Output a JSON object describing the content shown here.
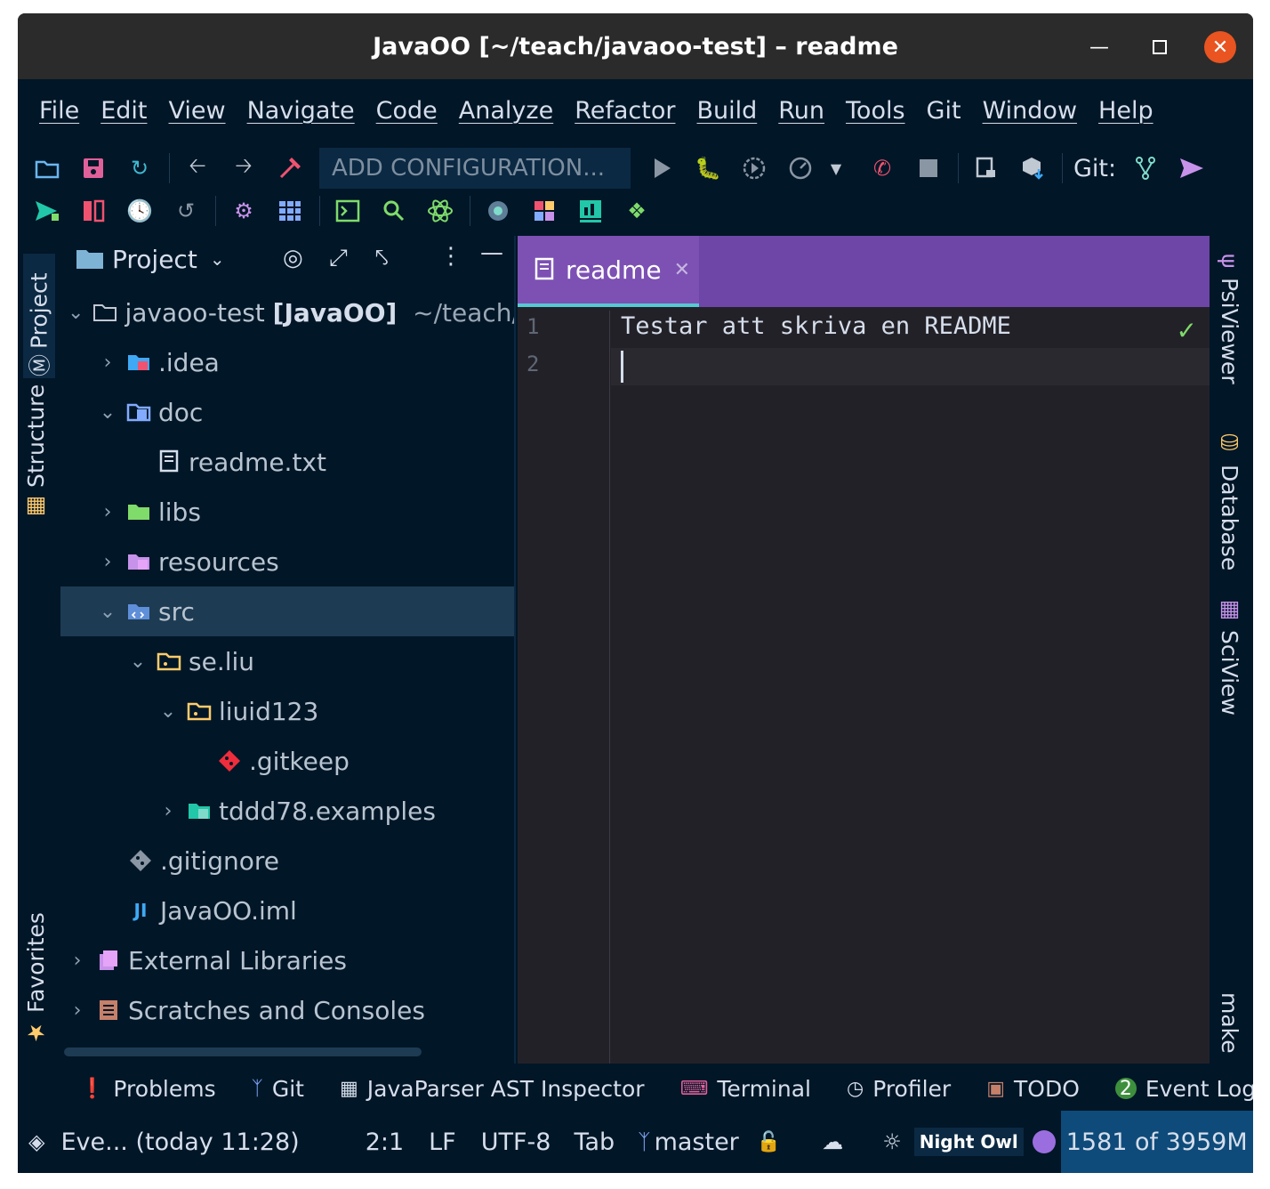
{
  "window": {
    "title": "JavaOO [~/teach/javaoo-test] – readme"
  },
  "menu": [
    "File",
    "Edit",
    "View",
    "Navigate",
    "Code",
    "Analyze",
    "Refactor",
    "Build",
    "Run",
    "Tools",
    "Git",
    "Window",
    "Help"
  ],
  "toolbar": {
    "add_config": "ADD CONFIGURATION...",
    "git_label": "Git:"
  },
  "left_tabs": {
    "project": "Project",
    "structure": "Structure",
    "favorites": "Favorites"
  },
  "project_panel": {
    "title": "Project",
    "tree": [
      {
        "name": "javaoo-test",
        "module": "[JavaOO]",
        "path": "~/teach/ja"
      },
      {
        "name": ".idea"
      },
      {
        "name": "doc"
      },
      {
        "name": "readme.txt"
      },
      {
        "name": "libs"
      },
      {
        "name": "resources"
      },
      {
        "name": "src"
      },
      {
        "name": "se.liu"
      },
      {
        "name": "liuid123"
      },
      {
        "name": ".gitkeep"
      },
      {
        "name": "tddd78.examples"
      },
      {
        "name": ".gitignore"
      },
      {
        "name": "JavaOO.iml"
      },
      {
        "name": "External Libraries"
      },
      {
        "name": "Scratches and Consoles"
      }
    ]
  },
  "editor": {
    "tab_label": "readme",
    "lines": [
      "1",
      "2"
    ],
    "line1": "Testar att skriva en README",
    "line2": ""
  },
  "right_tabs": {
    "psiviewer": "PsiViewer",
    "database": "Database",
    "sciview": "SciView",
    "make": "make"
  },
  "bottom_tabs": {
    "problems": "Problems",
    "git": "Git",
    "javaparser": "JavaParser AST Inspector",
    "terminal": "Terminal",
    "profiler": "Profiler",
    "todo": "TODO",
    "event_log": "Event Log",
    "event_count": "2"
  },
  "status": {
    "event": "Eve... (today 11:28)",
    "position": "2:1",
    "line_sep": "LF",
    "encoding": "UTF-8",
    "indent": "Tab",
    "branch": "master",
    "theme": "Night Owl",
    "memory": "1581 of 3959M"
  },
  "colors": {
    "background": "#011627",
    "accent": "#6d46a7",
    "selection": "#1d3b53"
  }
}
